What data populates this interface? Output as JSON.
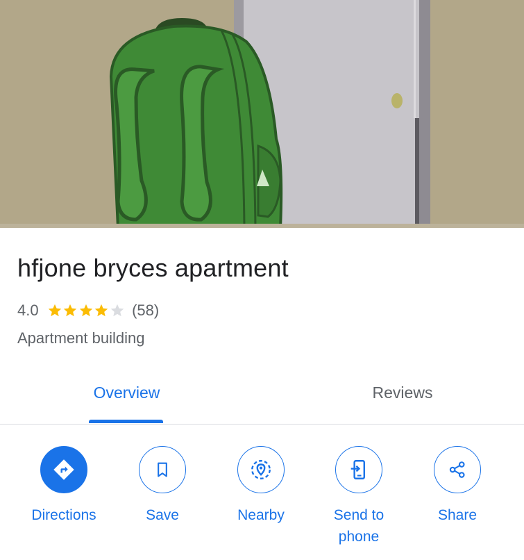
{
  "place": {
    "name": "hfjone bryces apartment",
    "rating": "4.0",
    "rating_stars": 4,
    "rating_max": 5,
    "review_count": "(58)",
    "category": "Apartment building",
    "hero_image": "cartoon-green-backpack-by-door"
  },
  "tabs": [
    {
      "label": "Overview",
      "selected": true
    },
    {
      "label": "Reviews",
      "selected": false
    }
  ],
  "actions": [
    {
      "label": "Directions",
      "icon": "directions-icon"
    },
    {
      "label": "Save",
      "icon": "bookmark-icon"
    },
    {
      "label": "Nearby",
      "icon": "nearby-pin-icon"
    },
    {
      "label": "Send to phone",
      "icon": "send-to-phone-icon"
    },
    {
      "label": "Share",
      "icon": "share-icon"
    }
  ],
  "colors": {
    "accent": "#1a73e8",
    "star": "#fbbc04",
    "star_empty": "#dadce0",
    "text_primary": "#202124",
    "text_secondary": "#5f6368"
  }
}
